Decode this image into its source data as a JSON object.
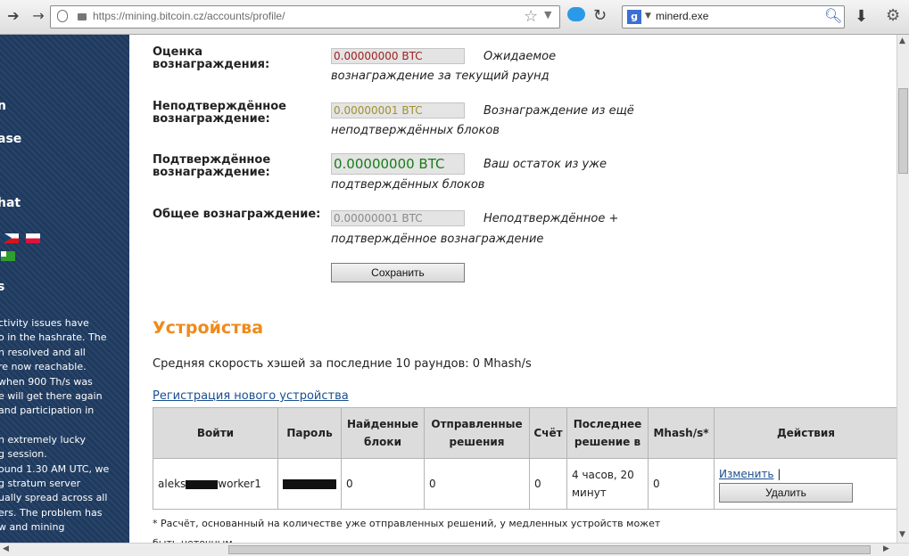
{
  "browser": {
    "url": "https://mining.bitcoin.cz/accounts/profile/",
    "search_text": "minerd.exe",
    "search_engine_icon": "g"
  },
  "sidebar": {
    "links": [
      "n",
      "ase",
      "hat",
      "s"
    ],
    "news": [
      "ctivity issues have",
      "o in the hashrate. The",
      "n resolved and all",
      "re now reachable.",
      " when 900 Th/s was",
      "e will get there again",
      " and participation in",
      "",
      "n extremely lucky",
      "g session.",
      "ound 1.30 AM UTC, we",
      "g stratum server",
      "ually spread across all",
      "ers. The problem has",
      "w and mining"
    ]
  },
  "rewards": {
    "estimated": {
      "label_line1": "Оценка",
      "label_line2": "вознаграждения:",
      "value": "0.00000000 BTC",
      "value_color": "#a02020",
      "desc_line1": "Ожидаемое",
      "desc_line2": "вознаграждение за текущий раунд"
    },
    "unconfirmed": {
      "label_line1": "Неподтверждённое",
      "label_line2": "вознаграждение:",
      "value": "0.00000001 BTC",
      "value_color": "#a09030",
      "desc_line1": "Вознаграждение из ещё",
      "desc_line2": "неподтверждённых блоков"
    },
    "confirmed": {
      "label_line1": "Подтверждённое",
      "label_line2": "вознаграждение:",
      "value": "0.00000000 BTC",
      "value_color": "#1a7a1a",
      "desc_line1": "Ваш остаток из уже",
      "desc_line2": "подтверждённых блоков"
    },
    "total": {
      "label": "Общее вознаграждение:",
      "value": "0.00000001 BTC",
      "value_color": "#8a8a8a",
      "desc_line1": "Неподтверждённое +",
      "desc_line2": "подтверждённое вознаграждение"
    },
    "save_label": "Сохранить"
  },
  "devices": {
    "title": "Устройства",
    "avg_hashrate": "Средняя скорость хэшей за последние 10 раундов: 0 Mhash/s",
    "register_link": "Регистрация нового устройства",
    "columns": {
      "login": "Войти",
      "password": "Пароль",
      "blocks_line1": "Найденные",
      "blocks_line2": "блоки",
      "shares_line1": "Отправленные",
      "shares_line2": "решения",
      "score": "Счёт",
      "last_line1": "Последнее",
      "last_line2": "решение в",
      "mhash": "Mhash/s*",
      "actions": "Действия"
    },
    "rows": [
      {
        "login_prefix": "aleks",
        "login_suffix": "worker1",
        "blocks": "0",
        "shares": "0",
        "score": "0",
        "last_line1": "4 часов, 20",
        "last_line2": "минут",
        "mhash": "0",
        "edit_label": "Изменить",
        "separator": "|",
        "delete_label": "Удалить"
      }
    ],
    "footnote_line1": "* Расчёт, основанный на количестве уже отправленных решений, у медленных устройств может",
    "footnote_line2": "быть неточным."
  },
  "colors": {
    "accent": "#f08a1a",
    "link": "#1a4e8f",
    "sidebar_bg": "#1e3a5f"
  }
}
